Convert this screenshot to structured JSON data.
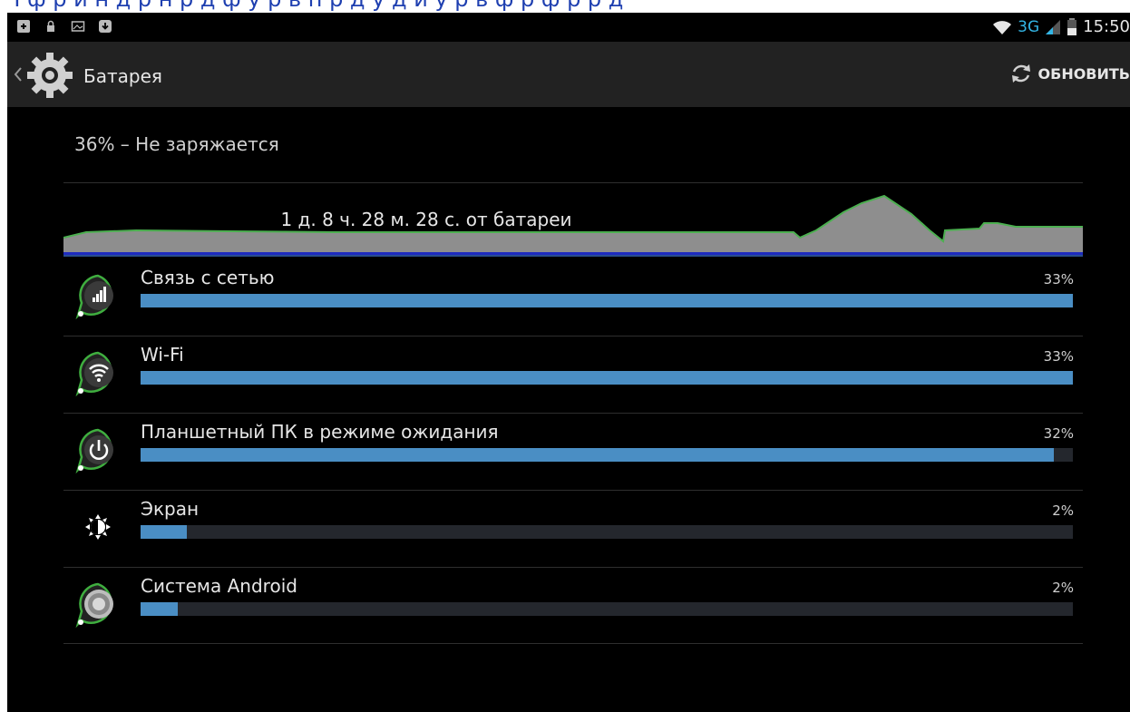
{
  "status_bar": {
    "network_type": "3G",
    "time": "15:50"
  },
  "action_bar": {
    "title": "Батарея",
    "refresh_label": "ОБНОВИТЬ"
  },
  "battery": {
    "summary": "36% – Не заряжается",
    "time_on_battery": "1 д. 8 ч. 28 м. 28 с. от батареи"
  },
  "usage": [
    {
      "label": "Связь с сетью",
      "percent_text": "33%",
      "fill": 1.0,
      "icon": "cell-signal-icon"
    },
    {
      "label": "Wi-Fi",
      "percent_text": "33%",
      "fill": 1.0,
      "icon": "wifi-icon"
    },
    {
      "label": "Планшетный ПК в режиме ожидания",
      "percent_text": "32%",
      "fill": 0.98,
      "icon": "power-icon"
    },
    {
      "label": "Экран",
      "percent_text": "2%",
      "fill": 0.05,
      "icon": "brightness-icon"
    },
    {
      "label": "Система Android",
      "percent_text": "2%",
      "fill": 0.04,
      "icon": "android-system-icon"
    }
  ],
  "colors": {
    "accent_blue": "#33b5e5",
    "bar_fill": "#4a8ec4",
    "bar_track": "#24272d",
    "graph_fill": "#8e8e8e",
    "graph_line": "#4caf50"
  }
}
